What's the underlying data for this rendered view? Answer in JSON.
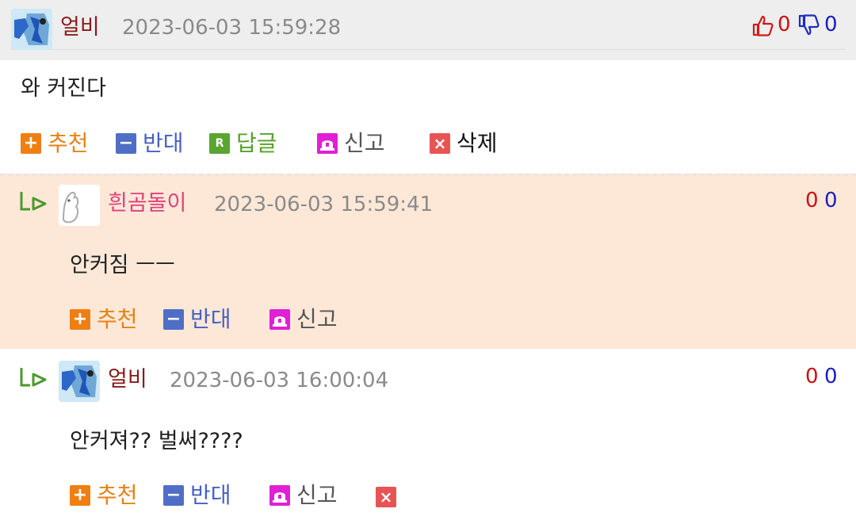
{
  "comments": [
    {
      "author": "얼비",
      "date": "2023-06-03 15:59:28",
      "content": "와 커진다",
      "likes": "0",
      "dislikes": "0",
      "actions": {
        "recommend": "추천",
        "oppose": "반대",
        "reply": "답글",
        "report": "신고",
        "delete": "삭제"
      }
    },
    {
      "author": "흰곰돌이",
      "date": "2023-06-03 15:59:41",
      "content": "안커짐 ㅡㅡ",
      "likes": "0",
      "dislikes": "0",
      "actions": {
        "recommend": "추천",
        "oppose": "반대",
        "report": "신고"
      }
    },
    {
      "author": "얼비",
      "date": "2023-06-03 16:00:04",
      "content": "안커져?? 벌써????",
      "likes": "0",
      "dislikes": "0",
      "actions": {
        "recommend": "추천",
        "oppose": "반대",
        "report": "신고"
      }
    }
  ],
  "colors": {
    "author_dark_red": "#8b1a1a",
    "author_pink": "#e0407a",
    "reply_background": "#fde8d8",
    "header_background": "#eeeeee"
  },
  "icons": [
    "thumbs-up-icon",
    "thumbs-down-icon",
    "reply-arrow-icon",
    "plus-icon",
    "minus-icon",
    "r-icon",
    "siren-icon",
    "x-icon"
  ]
}
